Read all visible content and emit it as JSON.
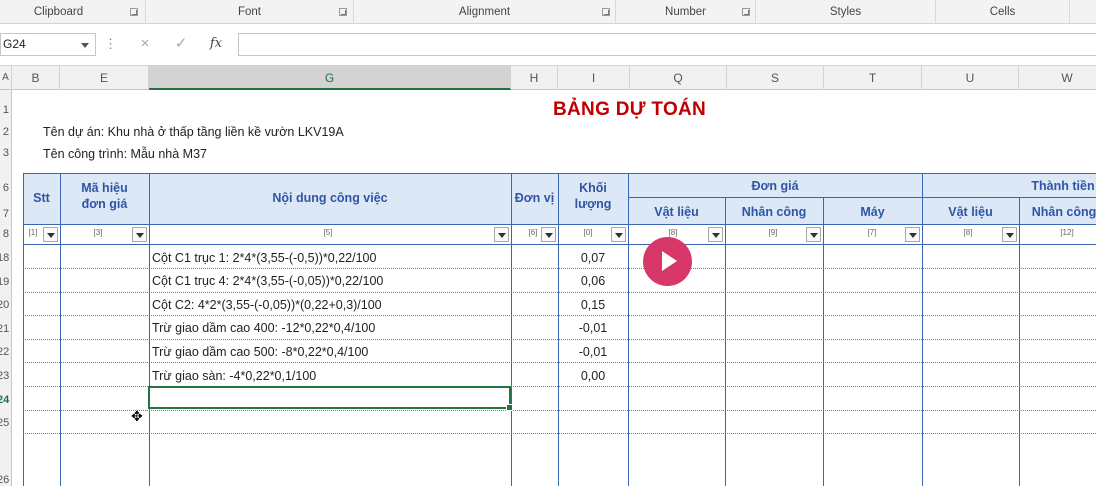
{
  "ribbon": {
    "groups": [
      "Clipboard",
      "Font",
      "Alignment",
      "Number",
      "Styles",
      "Cells"
    ]
  },
  "formula_bar": {
    "name_box": "G24",
    "cancel_icon": "×",
    "enter_icon": "✓",
    "fx_label": "fx",
    "formula": ""
  },
  "columns": [
    "A",
    "B",
    "E",
    "G",
    "H",
    "I",
    "Q",
    "S",
    "T",
    "U",
    "W"
  ],
  "rows": [
    "1",
    "2",
    "3",
    "6",
    "7",
    "8",
    "18",
    "19",
    "20",
    "21",
    "22",
    "23",
    "24",
    "25",
    "26"
  ],
  "sheet": {
    "title": "BẢNG DỰ TOÁN",
    "project_line": "Tên dự án: Khu nhà ở thấp tầng liền kề vườn LKV19A",
    "building_line": "Tên công trình: Mẫu nhà M37"
  },
  "table": {
    "headers": {
      "stt": "Stt",
      "code": "Mã hiệu đơn giá",
      "content": "Nội dung công việc",
      "unit": "Đơn vị",
      "qty": "Khối lượng",
      "unit_price": "Đơn giá",
      "amount": "Thành tiền",
      "material": "Vật liệu",
      "labor": "Nhân công",
      "machine": "Máy",
      "amount_material": "Vật liệu",
      "amount_labor": "Nhân công"
    },
    "filter_codes": [
      "[1]",
      "[3]",
      "[5]",
      "[6]",
      "[0]",
      "[8]",
      "[9]",
      "[7]",
      "[8]",
      "[12]"
    ],
    "rows": [
      {
        "content": "Cột C1 trục 1: 2*4*(3,55-(-0,5))*0,22/100",
        "qty": "0,07"
      },
      {
        "content": "Cột C1 trục 4: 2*4*(3,55-(-0,05))*0,22/100",
        "qty": "0,06"
      },
      {
        "content": "Cột C2: 4*2*(3,55-(-0,05))*(0,22+0,3)/100",
        "qty": "0,15"
      },
      {
        "content": "Trừ giao dầm cao 400: -12*0,22*0,4/100",
        "qty": "-0,01"
      },
      {
        "content": "Trừ giao dầm cao 500: -8*0,22*0,4/100",
        "qty": "-0,01"
      },
      {
        "content": "Trừ giao sàn: -4*0,22*0,1/100",
        "qty": "0,00"
      }
    ]
  },
  "active_cell": "G24"
}
